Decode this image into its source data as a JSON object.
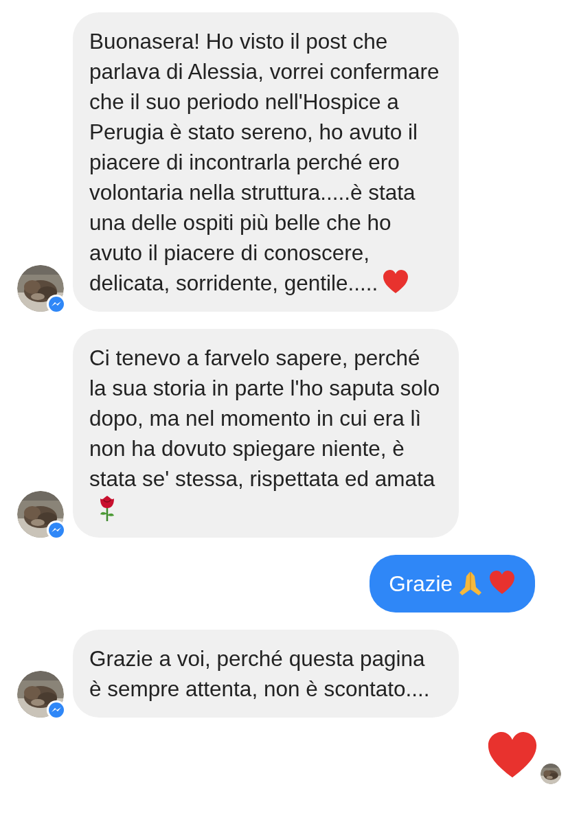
{
  "messages": [
    {
      "kind": "incoming",
      "text": "Buonasera! Ho visto il post che parlava di Alessia, vorrei confermare che il suo periodo nell'Hospice a Perugia è stato sereno, ho avuto il piacere di incontrarla perché ero volontaria nella struttura.....è stata una delle ospiti più belle che ho avuto il piacere di conoscere, delicata, sorridente, gentile.....",
      "icons": [
        {
          "kind": "heart"
        }
      ]
    },
    {
      "kind": "incoming",
      "text": "Ci tenevo a farvelo sapere, perché la sua storia in parte l'ho saputa solo dopo, ma nel momento in cui era lì non ha dovuto spiegare niente, è stata se' stessa, rispettata ed amata",
      "icons": [
        {
          "kind": "rose"
        }
      ]
    },
    {
      "kind": "outgoing",
      "text": "Grazie",
      "icons": [
        {
          "kind": "pray"
        },
        {
          "kind": "heart"
        }
      ]
    },
    {
      "kind": "incoming",
      "text": "Grazie a voi, perché questa pagina è sempre attenta, non è scontato...."
    },
    {
      "kind": "big-emoji",
      "icons": [
        {
          "kind": "heart"
        }
      ],
      "seen": true
    }
  ]
}
